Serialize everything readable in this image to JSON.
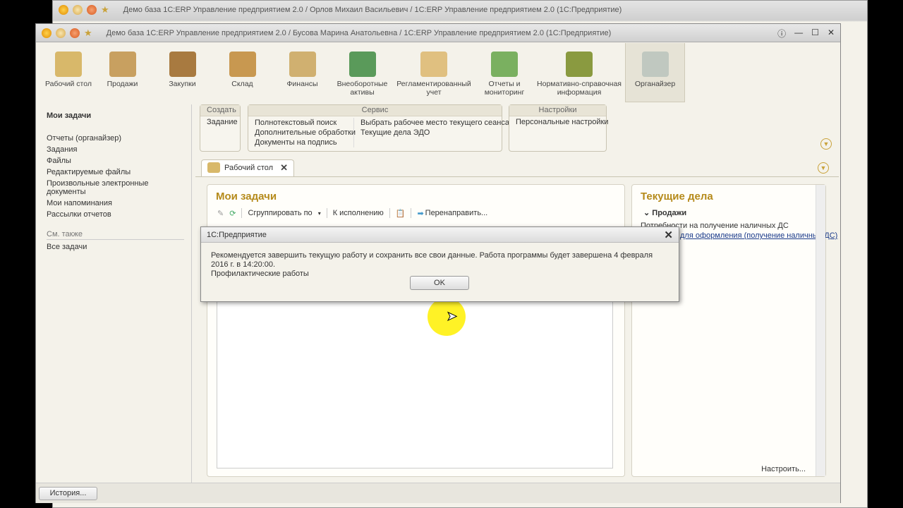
{
  "back_window": {
    "title": "Демо база 1С:ERP Управление предприятием 2.0 / Орлов Михаил Васильевич / 1С:ERP Управление предприятием 2.0  (1С:Предприятие)"
  },
  "main_window": {
    "title": "Демо база 1С:ERP Управление предприятием 2.0 / Бусова Марина Анатольевна / 1С:ERP Управление предприятием 2.0  (1С:Предприятие)"
  },
  "sections": [
    {
      "label": "Рабочий стол",
      "color": "#d8b86a"
    },
    {
      "label": "Продажи",
      "color": "#c8a060"
    },
    {
      "label": "Закупки",
      "color": "#a87a40"
    },
    {
      "label": "Склад",
      "color": "#c89850"
    },
    {
      "label": "Финансы",
      "color": "#d0b070"
    },
    {
      "label": "Внеоборотные активы",
      "color": "#5a9a5a"
    },
    {
      "label": "Регламентированный учет",
      "color": "#e0c080"
    },
    {
      "label": "Отчеты и мониторинг",
      "color": "#7ab060"
    },
    {
      "label": "Нормативно-справочная информация",
      "color": "#8a9a40"
    },
    {
      "label": "Органайзер",
      "color": "#c0c8c0"
    }
  ],
  "sidebar": {
    "title": "Мои задачи",
    "items": [
      "Отчеты (органайзер)",
      "Задания",
      "Файлы",
      "Редактируемые файлы",
      "Произвольные электронные документы",
      "Мои напоминания",
      "Рассылки отчетов"
    ],
    "see_also": "См. также",
    "see_items": [
      "Все задачи"
    ]
  },
  "commands": {
    "create": {
      "title": "Создать",
      "items": [
        "Задание"
      ]
    },
    "service": {
      "title": "Сервис",
      "col1": [
        "Полнотекстовый поиск",
        "Дополнительные обработки",
        "Документы на подпись"
      ],
      "col2": [
        "Выбрать рабочее место текущего сеанса",
        "Текущие дела ЭДО"
      ]
    },
    "settings": {
      "title": "Настройки",
      "items": [
        "Персональные настройки"
      ]
    }
  },
  "tab": {
    "label": "Рабочий стол"
  },
  "my_tasks": {
    "title": "Мои задачи",
    "group_by": "Сгруппировать по",
    "to_execute": "К исполнению",
    "redirect": "Перенаправить..."
  },
  "current": {
    "title": "Текущие дела",
    "group": "Продажи",
    "line1": "Потребности на получение наличных ДС",
    "link": "для оформления (получение наличных ДС)",
    "configure": "Настроить..."
  },
  "bottom": {
    "history": "История..."
  },
  "dialog": {
    "title": "1С:Предприятие",
    "message": "Рекомендуется завершить текущую работу и сохранить все свои данные. Работа программы будет завершена 4 февраля 2016 г. в 14:20:00.",
    "message2": "Профилактические работы",
    "ok": "OK"
  }
}
